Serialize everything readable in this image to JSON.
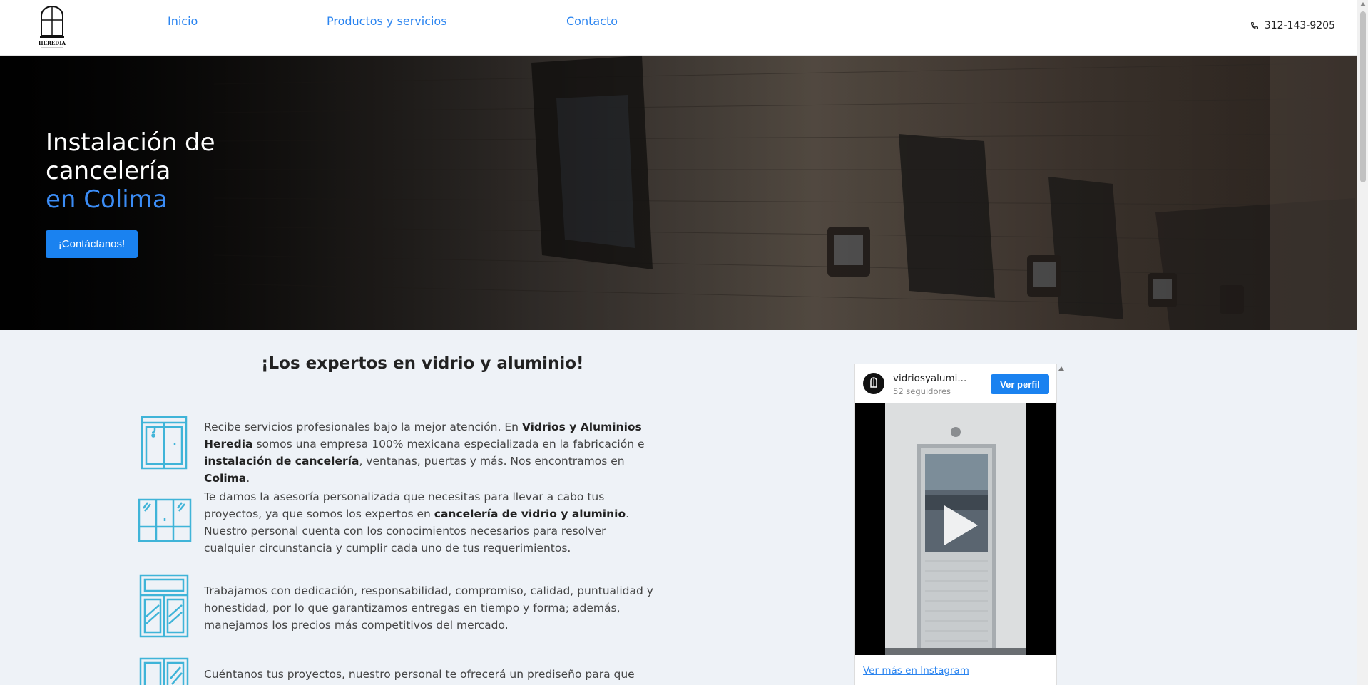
{
  "nav": {
    "items": [
      {
        "label": "Inicio"
      },
      {
        "label": "Productos y servicios"
      },
      {
        "label": "Contacto"
      }
    ],
    "phone": "312-143-9205"
  },
  "logo": {
    "text": "HEREDIA"
  },
  "hero": {
    "line1": "Instalación de",
    "line2": "cancelería",
    "accent": "en Colima",
    "button": "¡Contáctanos!"
  },
  "main": {
    "headline": "¡Los expertos en vidrio y aluminio!",
    "features": [
      {
        "icon": "sliding-door-icon"
      },
      {
        "icon": "window-panels-icon"
      },
      {
        "icon": "window-frame-icon"
      },
      {
        "icon": "glass-door-icon",
        "text": "Cuéntanos tus proyectos, nuestro personal te ofrecerá un prediseño para que puedas"
      }
    ],
    "f1": {
      "t1": "Recibe servicios profesionales bajo la mejor atención. En ",
      "b1": "Vidrios y Aluminios Heredia",
      "t2": " somos una empresa 100% mexicana especializada en la fabricación e ",
      "b2": "instalación de cancelería",
      "t3": ", ventanas, puertas y más. Nos encontramos en ",
      "b3": "Colima",
      "t4": "."
    },
    "f2": {
      "t1": "Te damos la asesoría personalizada que necesitas para llevar a cabo tus proyectos, ya que somos los expertos en ",
      "b1": "cancelería de vidrio y aluminio",
      "t2": ". Nuestro personal cuenta con los conocimientos necesarios para resolver cualquier circunstancia y cumplir cada uno de tus requerimientos."
    },
    "f3": {
      "t1": "Trabajamos con dedicación, responsabilidad, compromiso, calidad, puntualidad y honestidad, por lo que garantizamos entregas en tiempo y forma; además, manejamos los precios más competitivos del mercado."
    }
  },
  "instagram": {
    "username": "vidriosyalumi...",
    "followers": "52 seguidores",
    "profile_button": "Ver perfil",
    "more_link": "Ver más en Instagram"
  },
  "colors": {
    "accent": "#1a82f0",
    "icon": "#3fb4d8",
    "background": "#eef2f7"
  }
}
